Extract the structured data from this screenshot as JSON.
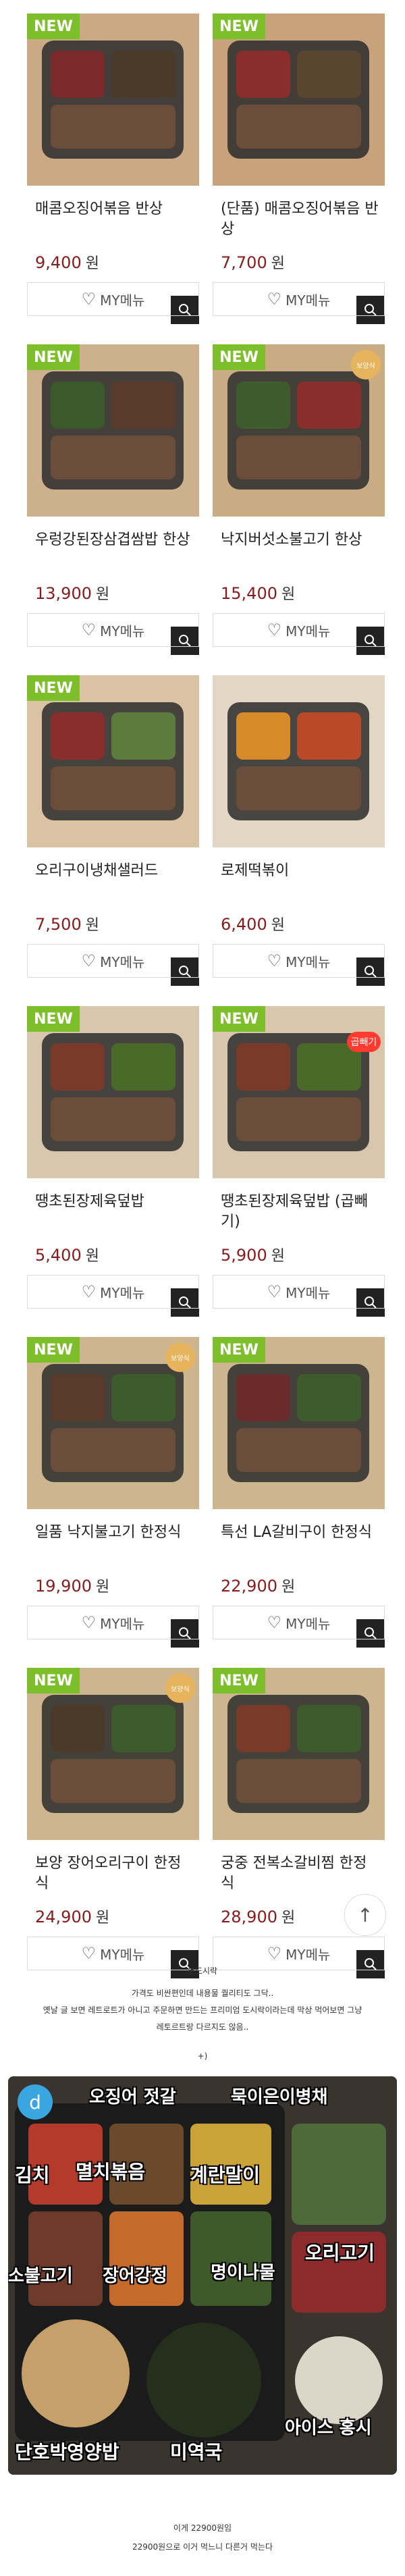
{
  "cards": [
    {
      "name": "매콤오징어볶음 반상",
      "price": "9,400",
      "new": "NEW",
      "mymenu": "MY메뉴"
    },
    {
      "name": "(단품) 매콤오징어볶음 반상",
      "price": "7,700",
      "new": "NEW",
      "mymenu": "MY메뉴"
    },
    {
      "name": "우렁강된장삼겹쌈밥 한상",
      "price": "13,900",
      "new": "NEW",
      "mymenu": "MY메뉴"
    },
    {
      "name": "낙지버섯소불고기 한상",
      "price": "15,400",
      "new": "NEW",
      "badge": "보양식",
      "mymenu": "MY메뉴"
    },
    {
      "name": "오리구이냉채샐러드",
      "price": "7,500",
      "new": "NEW",
      "mymenu": "MY메뉴"
    },
    {
      "name": "로제떡볶이",
      "price": "6,400",
      "mymenu": "MY메뉴"
    },
    {
      "name": "땡초된장제육덮밥",
      "price": "5,400",
      "new": "NEW",
      "mymenu": "MY메뉴"
    },
    {
      "name": "땡초된장제육덮밥 (곱빼기)",
      "price": "5,900",
      "new": "NEW",
      "redbadge": "곱빼기",
      "mymenu": "MY메뉴"
    },
    {
      "name": "일품 낙지불고기 한정식",
      "price": "19,900",
      "new": "NEW",
      "badge": "보양식",
      "mymenu": "MY메뉴"
    },
    {
      "name": "특선 LA갈비구이 한정식",
      "price": "22,900",
      "new": "NEW",
      "mymenu": "MY메뉴"
    },
    {
      "name": "보양 장어오리구이 한정식",
      "price": "24,900",
      "new": "NEW",
      "badge": "보양식",
      "mymenu": "MY메뉴"
    },
    {
      "name": "궁중 전복소갈비찜 한정식",
      "price": "28,900",
      "new": "NEW",
      "mymenu": "MY메뉴"
    }
  ],
  "currency": "원",
  "post": {
    "section_title": "본도시락",
    "lines": [
      "가격도 비싼편인데 내용물 퀄리티도 그닥..",
      "옛날 글 보면 레트로트가 아니고 주문하면 만드는 프리미엄 도시락이라는데 막상 먹어보면 그냥",
      "레토르트랑 다르지도 않음.."
    ],
    "aside": "+)",
    "photo_labels": [
      "오징어 젓갈",
      "묵이은이병채",
      "김치",
      "멸치볶음",
      "계란말이",
      "소불고기",
      "장어강정",
      "명이나물",
      "오리고기",
      "단호박영양밥",
      "미역국",
      "아이스 홍시"
    ],
    "caption1": "이게 22900원임",
    "caption2": "22900원으로 이거 먹느니 다른거 먹는다"
  },
  "icons": {
    "heart": "heart-icon",
    "zoom": "magnifier-icon",
    "up": "arrow-up-icon"
  }
}
